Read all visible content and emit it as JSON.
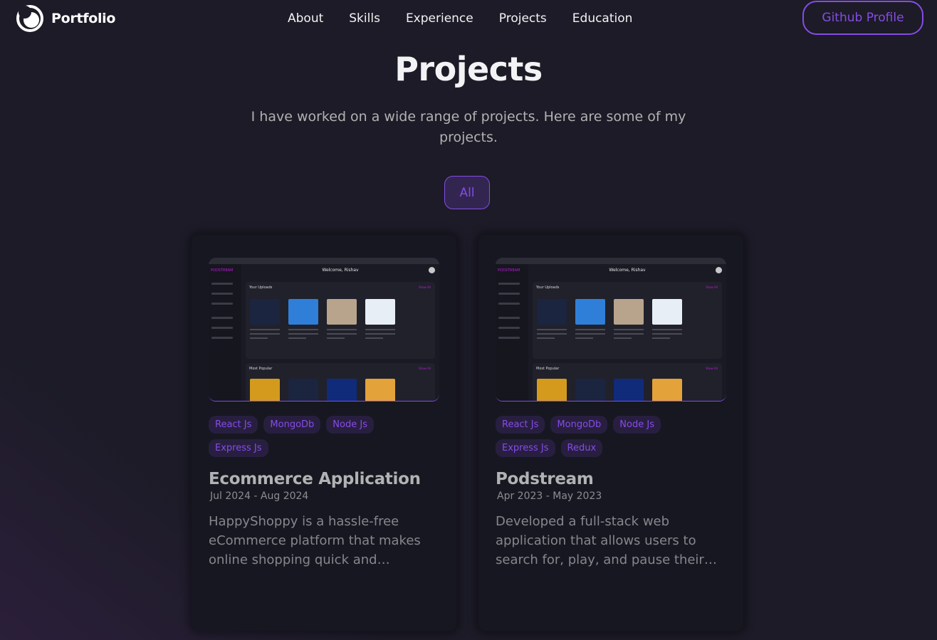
{
  "nav": {
    "logo_text": "Portfolio",
    "links": [
      "About",
      "Skills",
      "Experience",
      "Projects",
      "Education"
    ],
    "github_label": "Github Profile"
  },
  "section": {
    "title": "Projects",
    "subtitle": "I have worked on a wide range of projects. Here are some of my projects."
  },
  "filters": [
    "All"
  ],
  "projects": [
    {
      "title": "Ecommerce Application",
      "date": "Jul 2024 - Aug 2024",
      "tags": [
        "React Js",
        "MongoDb",
        "Node Js",
        "Express Js"
      ],
      "description": "HappyShoppy is a hassle-free eCommerce platform that makes online shopping quick and convenient."
    },
    {
      "title": "Podstream",
      "date": "Apr 2023 - May 2023",
      "tags": [
        "React Js",
        "MongoDb",
        "Node Js",
        "Express Js",
        "Redux"
      ],
      "description": "Developed a full-stack web application that allows users to search for, play, and pause their favorite podcasts."
    }
  ],
  "preview": {
    "brand": "PODSTREAM",
    "welcome": "Welcome, Rishav",
    "uploads_heading": "Your Uploads",
    "popular_heading": "Most Popular",
    "show_all": "Show All"
  },
  "colors": {
    "accent": "#854ce6",
    "background": "#1c1b27",
    "card": "#171721",
    "text_primary": "#f2f3f4",
    "text_secondary": "#b1b2b3"
  }
}
